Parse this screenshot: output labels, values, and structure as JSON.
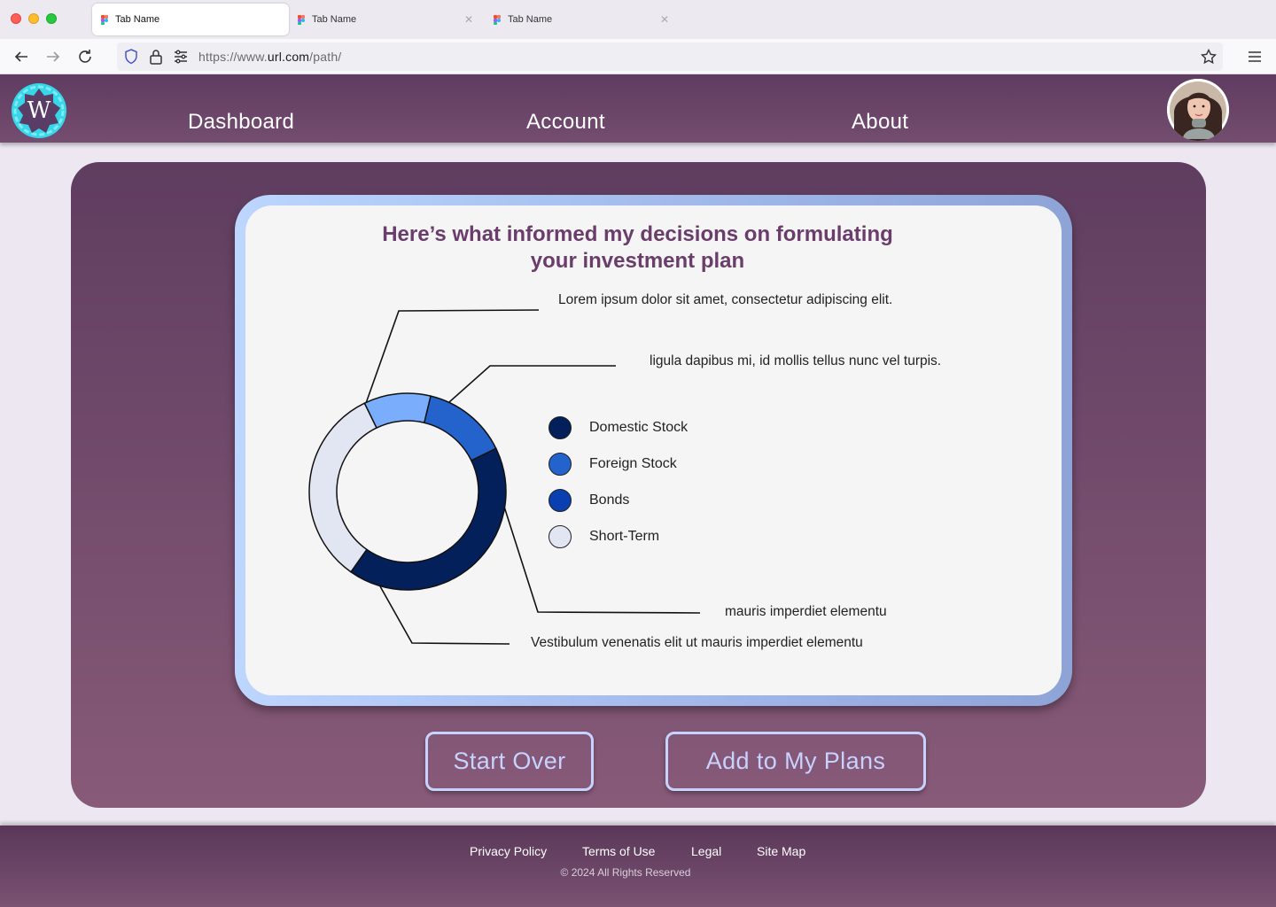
{
  "browser": {
    "tabs": [
      {
        "label": "Tab Name",
        "active": true
      },
      {
        "label": "Tab Name",
        "active": false
      },
      {
        "label": "Tab Name",
        "active": false
      }
    ],
    "url": {
      "prefix": "https://www.",
      "domain": "url.com",
      "path": "/path/"
    }
  },
  "header": {
    "logo_letter": "W",
    "nav": [
      "Dashboard",
      "Account",
      "About"
    ]
  },
  "card": {
    "title_line1": "Here’s what informed my decisions on formulating",
    "title_line2": "your investment plan",
    "callouts": [
      "Lorem ipsum dolor sit amet, consectetur adipiscing elit.",
      "ligula dapibus mi, id mollis tellus nunc vel turpis.",
      "mauris imperdiet elementu",
      "Vestibulum  venenatis elit ut mauris imperdiet elementu"
    ]
  },
  "chart_data": {
    "type": "pie",
    "subtype": "donut",
    "categories": [
      "Domestic Stock",
      "Foreign Stock",
      "Bonds",
      "Short-Term"
    ],
    "legend": [
      {
        "label": "Domestic Stock",
        "color": "#03205a"
      },
      {
        "label": "Foreign Stock",
        "color": "#2462cc"
      },
      {
        "label": "Bonds",
        "color": "#0a3fb0"
      },
      {
        "label": "Short-Term",
        "color": "#e2e6f2"
      }
    ],
    "segments": [
      {
        "label": "Foreign Stock",
        "value": 11,
        "color": "#7aaefc"
      },
      {
        "label": "Bonds",
        "value": 14,
        "color": "#2462cc"
      },
      {
        "label": "Domestic Stock",
        "value": 42,
        "color": "#03205a"
      },
      {
        "label": "Short-Term",
        "value": 33,
        "color": "#e2e6f2"
      }
    ]
  },
  "actions": {
    "start_over": "Start Over",
    "add_to_plans": "Add to My Plans"
  },
  "footer": {
    "links": [
      "Privacy Policy",
      "Terms of Use",
      "Legal",
      "Site Map"
    ],
    "copyright": "© 2024 All Rights Reserved"
  }
}
